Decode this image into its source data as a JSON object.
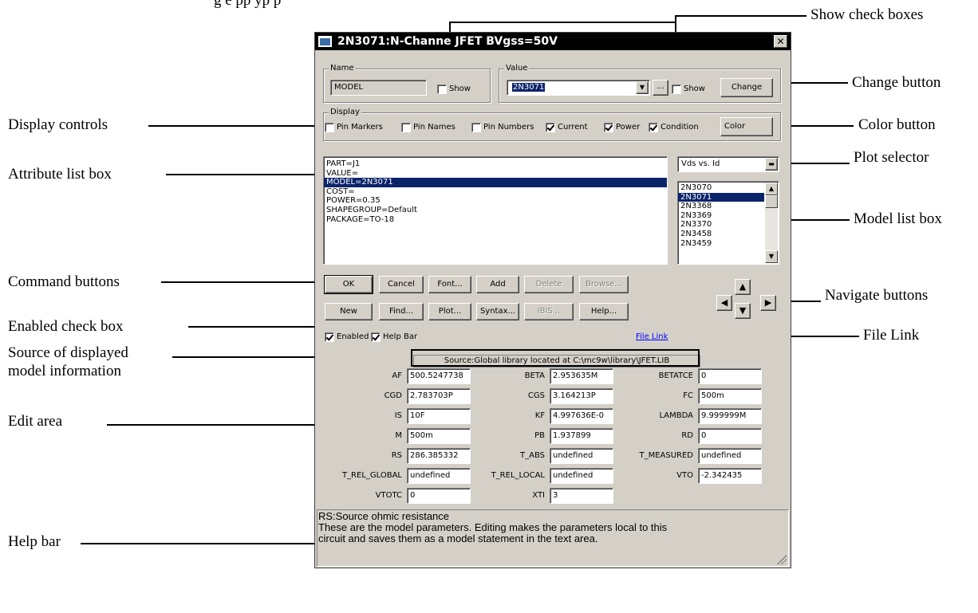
{
  "top_caption": "g        e  pp           yp           p",
  "callouts": {
    "show_check_boxes": "Show check boxes",
    "change_button": "Change button",
    "display_controls": "Display controls",
    "color_button": "Color button",
    "attribute_list_box": "Attribute list box",
    "plot_selector": "Plot selector",
    "model_list_box": "Model list box",
    "command_buttons": "Command buttons",
    "navigate_buttons": "Navigate buttons",
    "enabled_check_box": "Enabled check box",
    "file_link": "File Link",
    "source_line1": "Source of displayed",
    "source_line2": "model information",
    "edit_area": "Edit area",
    "help_bar": "Help bar"
  },
  "dialog": {
    "title": "2N3071:N-Channe  JFET BVgss=50V",
    "close_glyph": "✕",
    "name_group": {
      "label": "Name",
      "value": "MODEL",
      "show_label": "Show",
      "show_checked": false
    },
    "value_group": {
      "label": "Value",
      "value": "2N3071",
      "browse_label": "...",
      "show_label": "Show",
      "show_checked": false,
      "change_label": "Change"
    },
    "display_group": {
      "label": "Display",
      "checkboxes": [
        {
          "label": "Pin Markers",
          "checked": false
        },
        {
          "label": "Pin Names",
          "checked": false
        },
        {
          "label": "Pin Numbers",
          "checked": false
        },
        {
          "label": "Current",
          "checked": true
        },
        {
          "label": "Power",
          "checked": true
        },
        {
          "label": "Condition",
          "checked": true
        }
      ],
      "color_label": "Color"
    },
    "attributes": [
      "PART=J1",
      "VALUE=",
      "MODEL=2N3071",
      "COST=",
      "POWER=0.35",
      "SHAPEGROUP=Default",
      "PACKAGE=TO-18"
    ],
    "attributes_selected_index": 2,
    "plot_selector": "Vds vs. Id",
    "models": [
      "2N3070",
      "2N3071",
      "2N3368",
      "2N3369",
      "2N3370",
      "2N3458",
      "2N3459"
    ],
    "models_selected_index": 1,
    "buttons_row1": [
      {
        "label": "OK",
        "enabled": true,
        "default": true
      },
      {
        "label": "Cancel",
        "enabled": true
      },
      {
        "label": "Font...",
        "enabled": true
      },
      {
        "label": "Add",
        "enabled": true
      },
      {
        "label": "Delete",
        "enabled": false
      },
      {
        "label": "Browse...",
        "enabled": false
      }
    ],
    "buttons_row2": [
      {
        "label": "New",
        "enabled": true
      },
      {
        "label": "Find...",
        "enabled": true
      },
      {
        "label": "Plot...",
        "enabled": true
      },
      {
        "label": "Syntax...",
        "enabled": true
      },
      {
        "label": "IBIS...",
        "enabled": false
      },
      {
        "label": "Help...",
        "enabled": true
      }
    ],
    "nav": {
      "up": "▲",
      "down": "▼",
      "left": "◀",
      "right": "▶"
    },
    "enabled": {
      "label": "Enabled",
      "checked": true
    },
    "help_bar_cb": {
      "label": "Help Bar",
      "checked": true
    },
    "file_link": "File Link",
    "source": "Source:Global library located at C:\\mc9w\\library\\JFET.LIB",
    "params": [
      {
        "name": "AF",
        "value": "500.5247738"
      },
      {
        "name": "BETA",
        "value": "2.953635M"
      },
      {
        "name": "BETATCE",
        "value": "0"
      },
      {
        "name": "CGD",
        "value": "2.783703P"
      },
      {
        "name": "CGS",
        "value": "3.164213P"
      },
      {
        "name": "FC",
        "value": "500m"
      },
      {
        "name": "IS",
        "value": "10F"
      },
      {
        "name": "KF",
        "value": "4.997636E-0"
      },
      {
        "name": "LAMBDA",
        "value": "9.999999M"
      },
      {
        "name": "M",
        "value": "500m"
      },
      {
        "name": "PB",
        "value": "1.937899"
      },
      {
        "name": "RD",
        "value": "0"
      },
      {
        "name": "RS",
        "value": "286.385332"
      },
      {
        "name": "T_ABS",
        "value": "undefined"
      },
      {
        "name": "T_MEASURED",
        "value": "undefined"
      },
      {
        "name": "T_REL_GLOBAL",
        "value": "undefined"
      },
      {
        "name": "T_REL_LOCAL",
        "value": "undefined"
      },
      {
        "name": "VTO",
        "value": "-2.342435"
      },
      {
        "name": "VTOTC",
        "value": "0"
      },
      {
        "name": "XTI",
        "value": "3"
      }
    ],
    "help_text": [
      "RS:Source ohmic resistance",
      "These are the model parameters. Editing makes the parameters local to this",
      "circuit and saves them as a model statement in the text area."
    ]
  }
}
